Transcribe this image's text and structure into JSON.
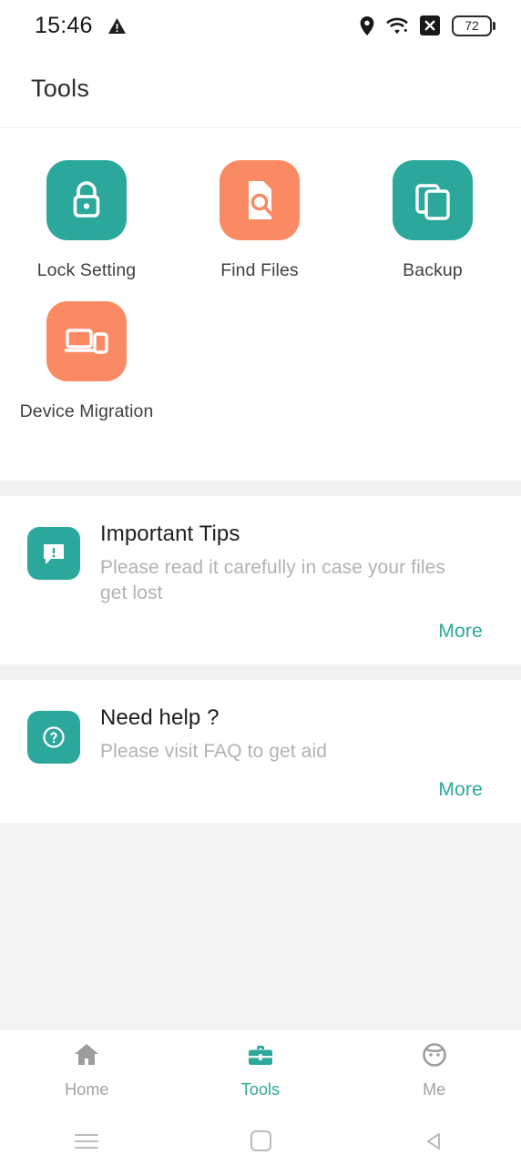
{
  "status_bar": {
    "time": "15:46",
    "warning_icon": "warning-triangle-icon",
    "location_icon": "location-pin-icon",
    "wifi_icon": "wifi-icon",
    "nosim_icon": "no-sim-x-icon",
    "battery_level": "72"
  },
  "header": {
    "title": "Tools"
  },
  "tools": [
    {
      "label": "Lock Setting",
      "icon": "lock-icon",
      "color": "#2ba89b"
    },
    {
      "label": "Find Files",
      "icon": "file-search-icon",
      "color": "#fa8a63"
    },
    {
      "label": "Backup",
      "icon": "copy-documents-icon",
      "color": "#2ba89b"
    },
    {
      "label": "Device Migration",
      "icon": "laptop-phone-icon",
      "color": "#fa8a63"
    }
  ],
  "cards": [
    {
      "title": "Important Tips",
      "desc": "Please read it carefully in case your files get lost",
      "more": "More",
      "icon": "speech-bubble-alert-icon",
      "color": "#2ba89b"
    },
    {
      "title": "Need help ?",
      "desc": "Please visit FAQ to get aid",
      "more": "More",
      "icon": "question-circle-icon",
      "color": "#2ba89b"
    }
  ],
  "bottom_nav": [
    {
      "label": "Home",
      "icon": "home-icon",
      "active": false
    },
    {
      "label": "Tools",
      "icon": "briefcase-icon",
      "active": true
    },
    {
      "label": "Me",
      "icon": "person-face-icon",
      "active": false
    }
  ],
  "system_nav": [
    {
      "icon": "recents-menu-icon"
    },
    {
      "icon": "home-square-icon"
    },
    {
      "icon": "back-triangle-icon"
    }
  ],
  "colors": {
    "accent": "#2ba89b",
    "secondary": "#fa8a63",
    "muted": "#b0b2b4"
  }
}
